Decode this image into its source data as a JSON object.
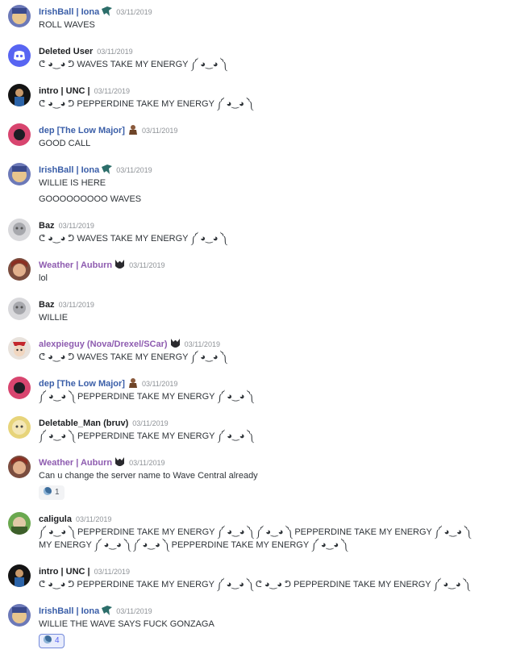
{
  "colors": {
    "role_blue": "#3a5ea8",
    "role_purple": "#8e5cb0",
    "default_name": "#1d1f22",
    "timestamp": "#8e9297",
    "reaction_active_border": "#7289da"
  },
  "messages": [
    {
      "author": "IrishBall | Iona",
      "timestamp": "03/11/2019",
      "lines": [
        "ROLL WAVES"
      ]
    },
    {
      "author": "Deleted User",
      "timestamp": "03/11/2019",
      "lines": [
        "ᕦ ◕‿◕ ᕤ WAVES TAKE MY ENERGY ༼ ◕‿◕ ༽"
      ]
    },
    {
      "author": "intro | UNC |",
      "timestamp": "03/11/2019",
      "lines": [
        "ᕦ ◕‿◕ ᕤ PEPPERDINE TAKE MY ENERGY ༼ ◕‿◕ ༽"
      ]
    },
    {
      "author": "dep [The Low Major]",
      "timestamp": "03/11/2019",
      "lines": [
        "GOOD CALL"
      ]
    },
    {
      "author": "IrishBall | Iona",
      "timestamp": "03/11/2019",
      "lines": [
        "WILLIE IS HERE",
        "GOOOOOOOOO WAVES"
      ]
    },
    {
      "author": "Baz",
      "timestamp": "03/11/2019",
      "lines": [
        "ᕦ ◕‿◕ ᕤ WAVES TAKE MY ENERGY ༼ ◕‿◕ ༽"
      ]
    },
    {
      "author": "Weather | Auburn",
      "timestamp": "03/11/2019",
      "lines": [
        "lol"
      ]
    },
    {
      "author": "Baz",
      "timestamp": "03/11/2019",
      "lines": [
        "WILLIE"
      ]
    },
    {
      "author": "alexpieguy (Nova/Drexel/SCar)",
      "timestamp": "03/11/2019",
      "lines": [
        "ᕦ ◕‿◕ ᕤ WAVES TAKE MY ENERGY ༼ ◕‿◕ ༽"
      ]
    },
    {
      "author": "dep [The Low Major]",
      "timestamp": "03/11/2019",
      "lines": [
        "༼ ◕‿◕ ༽ PEPPERDINE TAKE MY ENERGY ༼ ◕‿◕ ༽"
      ]
    },
    {
      "author": "Deletable_Man (bruv)",
      "timestamp": "03/11/2019",
      "lines": [
        "༼ ◕‿◕ ༽ PEPPERDINE TAKE MY ENERGY ༼ ◕‿◕ ༽"
      ]
    },
    {
      "author": "Weather | Auburn",
      "timestamp": "03/11/2019",
      "lines": [
        "Can u change the server name to Wave Central already"
      ],
      "reaction": {
        "count": "1",
        "active": false
      }
    },
    {
      "author": "caligula",
      "timestamp": "03/11/2019",
      "lines": [
        "༼ ◕‿◕ ༽ PEPPERDINE TAKE MY ENERGY ༼ ◕‿◕ ༽ ༼ ◕‿◕ ༽ PEPPERDINE TAKE MY ENERGY ༼ ◕‿◕ ༽",
        "MY ENERGY ༼ ◕‿◕ ༽ ༼ ◕‿◕ ༽ PEPPERDINE TAKE MY ENERGY ༼ ◕‿◕ ༽"
      ]
    },
    {
      "author": "intro | UNC |",
      "timestamp": "03/11/2019",
      "lines": [
        "ᕦ ◕‿◕ ᕤ PEPPERDINE TAKE MY ENERGY ༼ ◕‿◕ ༽ ᕦ ◕‿◕ ᕤ PEPPERDINE TAKE MY ENERGY ༼ ◕‿◕ ༽"
      ]
    },
    {
      "author": "IrishBall | Iona",
      "timestamp": "03/11/2019",
      "lines": [
        "WILLIE THE WAVE SAYS FUCK GONZAGA"
      ],
      "reaction": {
        "count": "4",
        "active": true
      }
    }
  ]
}
